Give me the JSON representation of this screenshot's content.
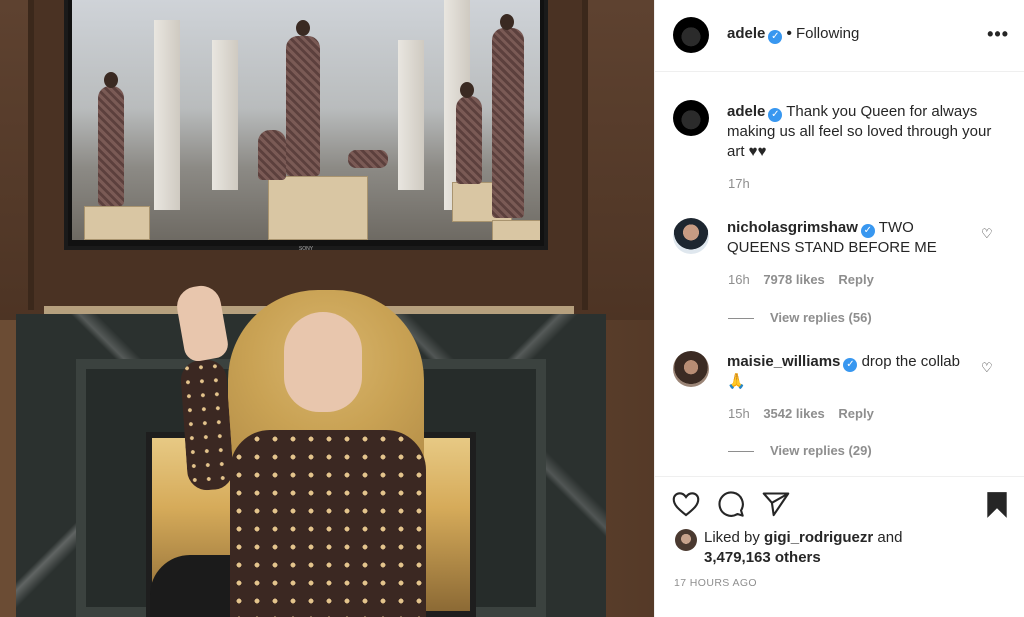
{
  "post": {
    "author": "adele",
    "follow_state": "Following",
    "more_icon": "•••",
    "caption": {
      "username": "adele",
      "text": "Thank you Queen for always making us all feel so loved through your art ♥♥",
      "time": "17h"
    },
    "comments": [
      {
        "username": "nicholasgrimshaw",
        "text": "TWO QUEENS STAND BEFORE ME",
        "time": "16h",
        "likes": "7978 likes",
        "reply_label": "Reply",
        "view_replies": "View replies (56)"
      },
      {
        "username": "maisie_williams",
        "text": "drop the collab 🙏",
        "time": "15h",
        "likes": "3542 likes",
        "reply_label": "Reply",
        "view_replies": "View replies (29)"
      }
    ],
    "liked_by": {
      "prefix": "Liked by",
      "user": "gigi_rodriguezr",
      "and": "and",
      "count": "3,479,163 others"
    },
    "timestamp": "17 HOURS AGO"
  },
  "tv_brand": "SONY",
  "icons": {
    "verified": "✓",
    "heart_small": "♡"
  },
  "colors": {
    "accent": "#3897f0",
    "text": "#262626",
    "muted": "#8e8e8e"
  }
}
